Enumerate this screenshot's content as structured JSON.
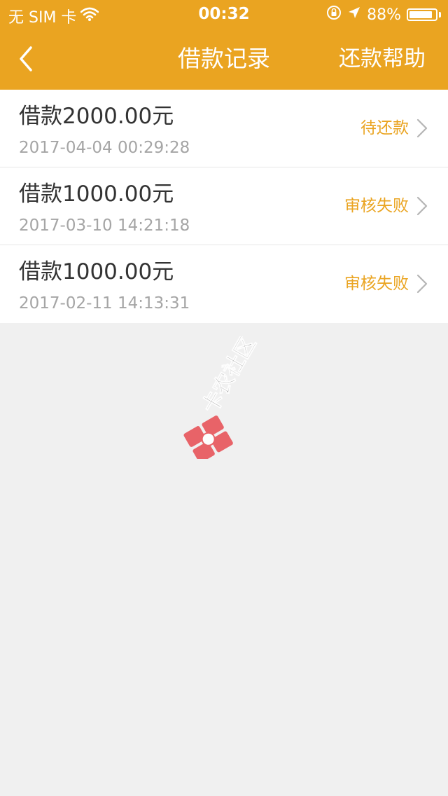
{
  "status_bar": {
    "carrier": "无 SIM 卡",
    "time": "00:32",
    "battery": "88%",
    "battery_level": 0.88
  },
  "nav": {
    "title": "借款记录",
    "help": "还款帮助"
  },
  "records": [
    {
      "amount": "借款2000.00元",
      "time": "2017-04-04 00:29:28",
      "status": "待还款"
    },
    {
      "amount": "借款1000.00元",
      "time": "2017-03-10 14:21:18",
      "status": "审核失败"
    },
    {
      "amount": "借款1000.00元",
      "time": "2017-02-11 14:13:31",
      "status": "审核失败"
    }
  ],
  "watermark": {
    "text": "卡农社区"
  },
  "colors": {
    "header": "#eaa421",
    "status_text": "#eaa421",
    "background": "#f0f0f0"
  }
}
